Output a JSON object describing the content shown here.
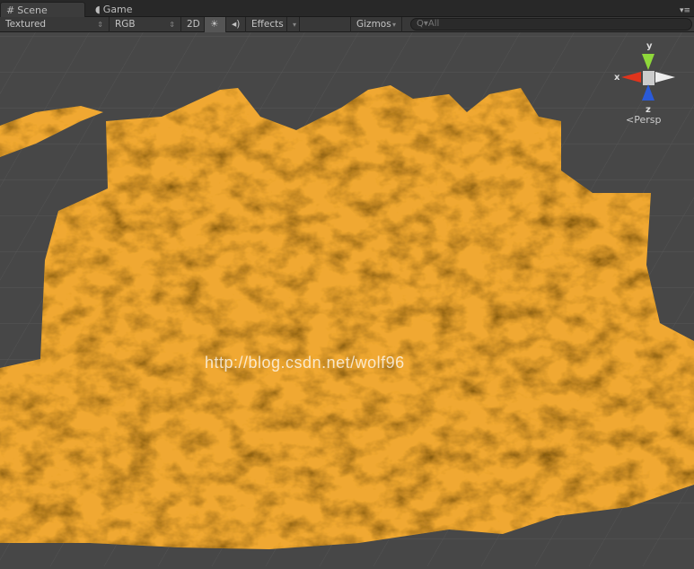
{
  "tabs": [
    {
      "label": "Scene",
      "icon": "grid-icon"
    },
    {
      "label": "Game",
      "icon": "pacman-icon"
    }
  ],
  "toolbar": {
    "shading": "Textured",
    "channel": "RGB",
    "mode_2d": "2D",
    "lighting_icon": "sun-icon",
    "audio_icon": "speaker-icon",
    "effects": "Effects",
    "gizmos": "Gizmos",
    "search_placeholder": "All"
  },
  "scene": {
    "watermark": "http://blog.csdn.net/wolf96",
    "terrain_color": "#f0a830"
  },
  "gizmo": {
    "x": "x",
    "y": "y",
    "z": "z",
    "projection": "Persp"
  }
}
